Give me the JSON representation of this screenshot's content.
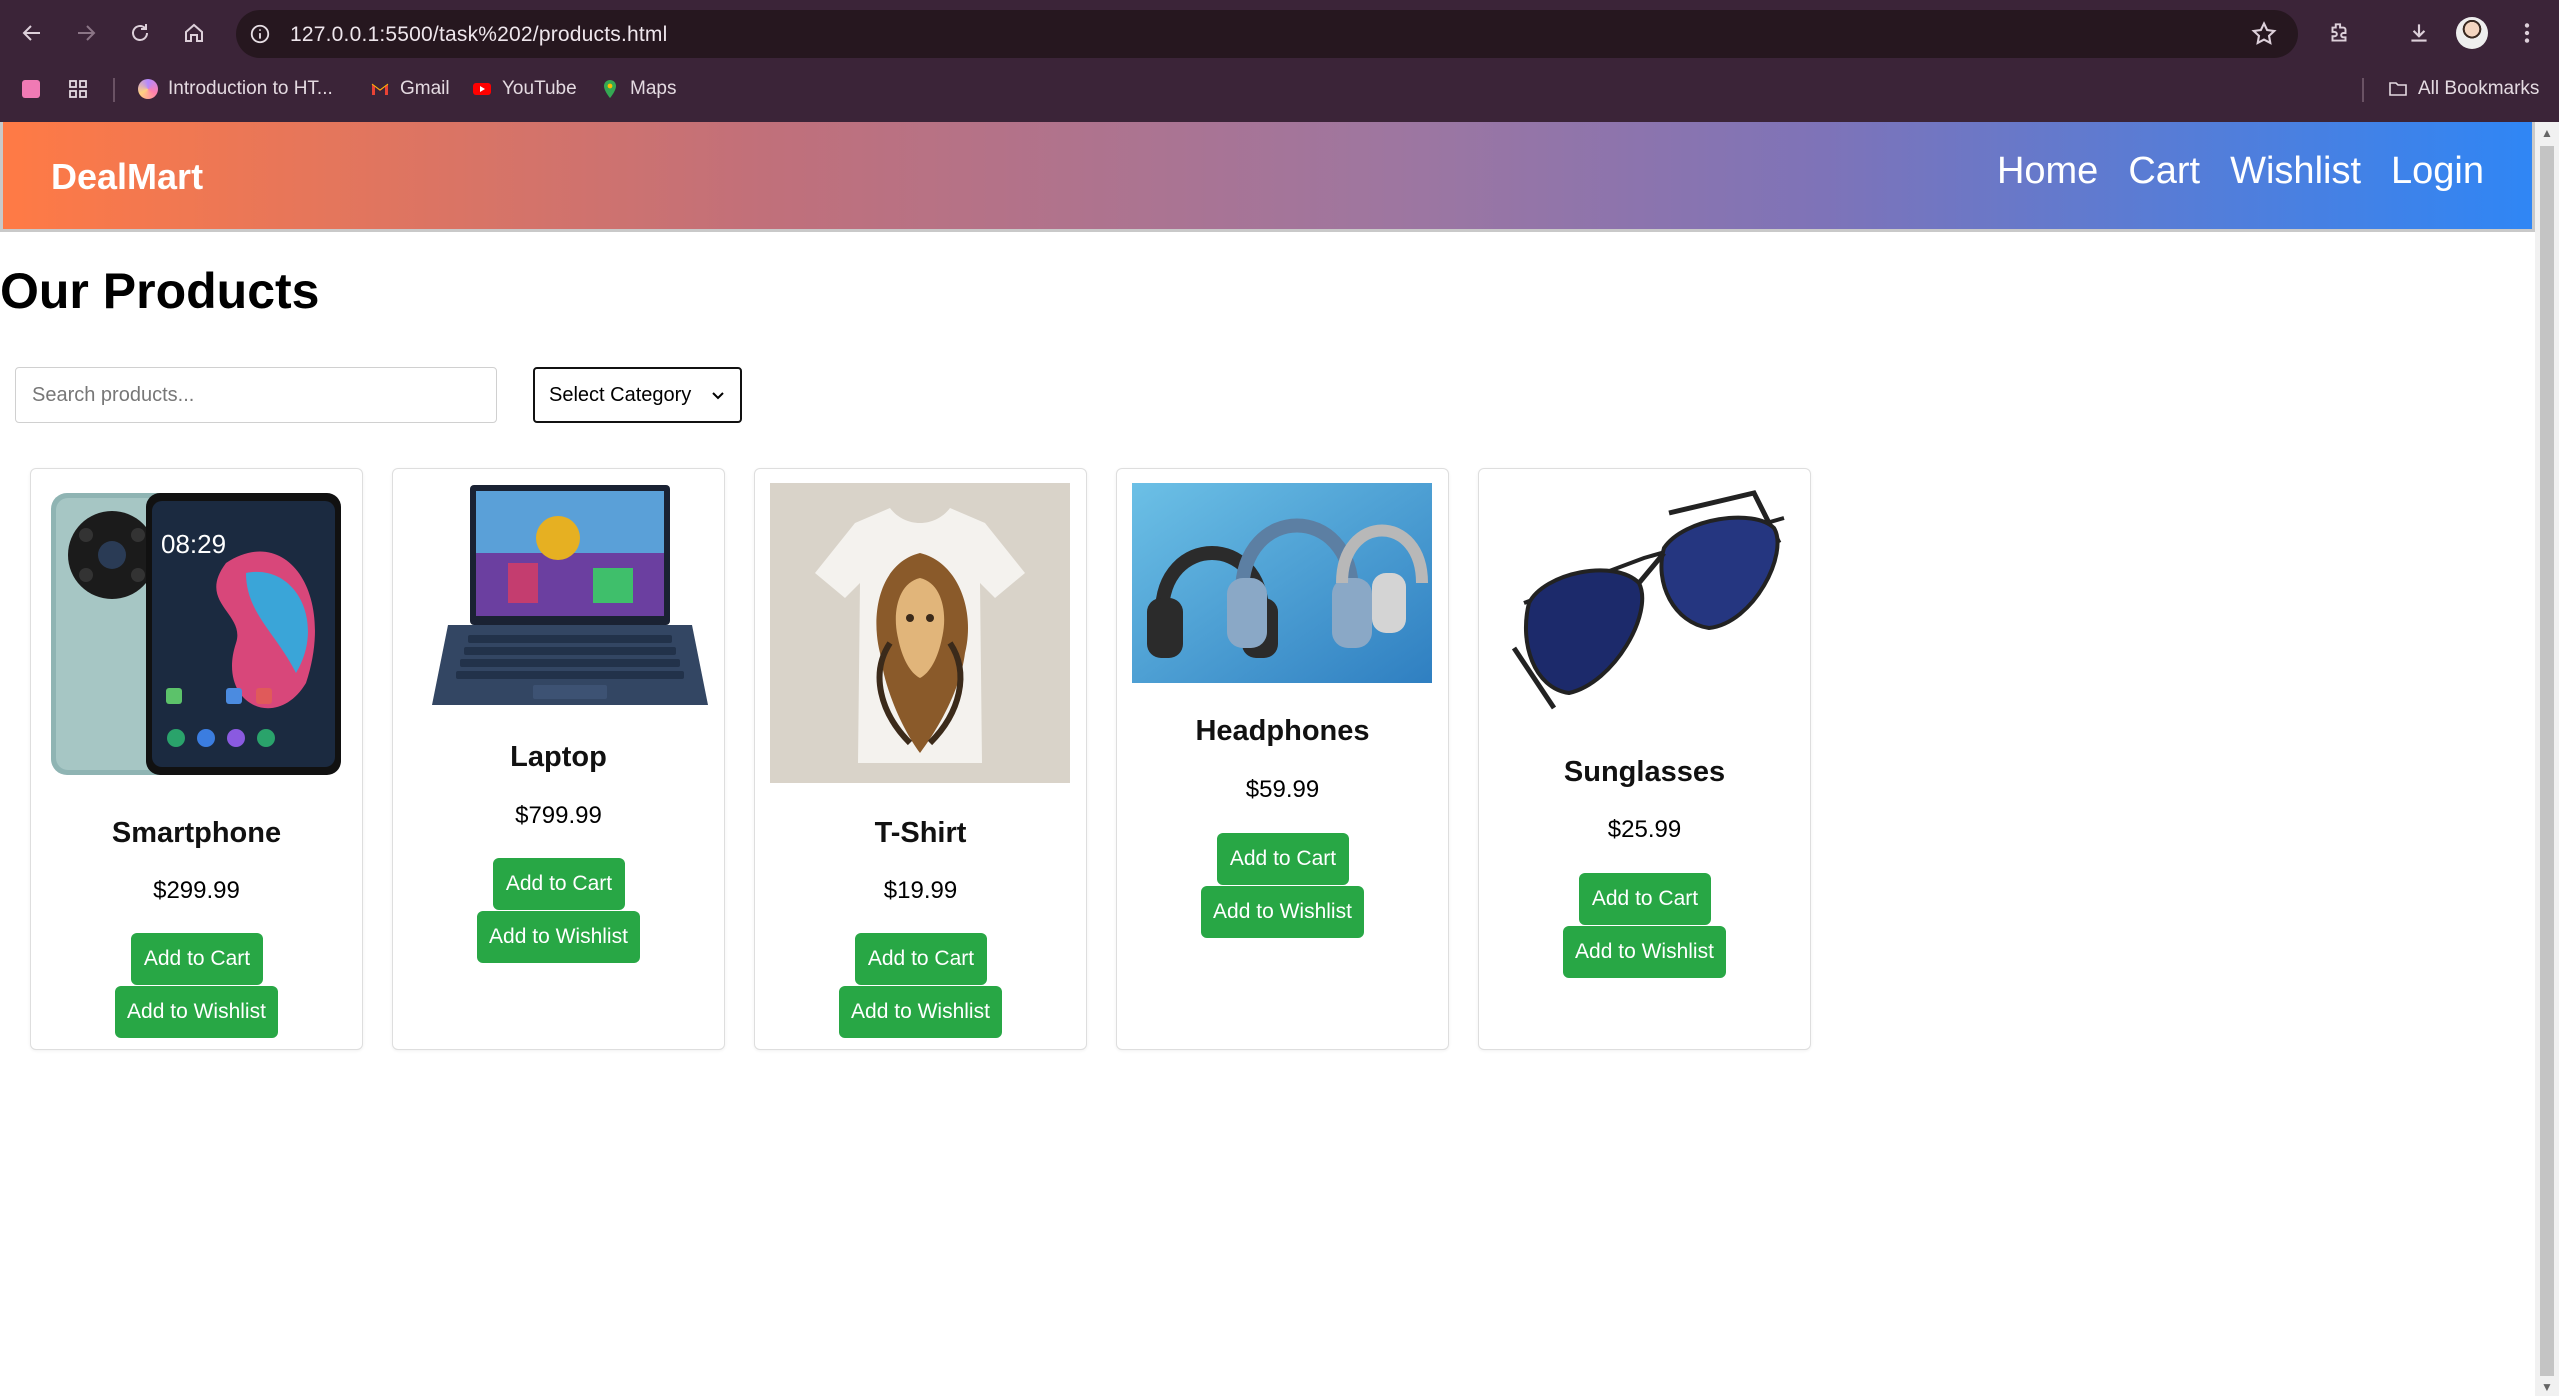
{
  "browser": {
    "url": "127.0.0.1:5500/task%202/products.html",
    "bookmarks": [
      {
        "label": "Introduction to HT..."
      },
      {
        "label": "Gmail"
      },
      {
        "label": "YouTube"
      },
      {
        "label": "Maps"
      }
    ],
    "all_bookmarks": "All Bookmarks"
  },
  "site": {
    "brand": "DealMart",
    "nav": [
      "Home",
      "Cart",
      "Wishlist",
      "Login"
    ]
  },
  "page": {
    "title": "Our Products",
    "search_placeholder": "Search products...",
    "category_select": "Select Category"
  },
  "products": [
    {
      "name": "Smartphone",
      "price": "$299.99",
      "image": "smartphone-image",
      "cart_label": "Add to Cart",
      "wishlist_label": "Add to Wishlist"
    },
    {
      "name": "Laptop",
      "price": "$799.99",
      "image": "laptop-image",
      "cart_label": "Add to Cart",
      "wishlist_label": "Add to Wishlist"
    },
    {
      "name": "T-Shirt",
      "price": "$19.99",
      "image": "tshirt-image",
      "cart_label": "Add to Cart",
      "wishlist_label": "Add to Wishlist"
    },
    {
      "name": "Headphones",
      "price": "$59.99",
      "image": "headphones-image",
      "cart_label": "Add to Cart",
      "wishlist_label": "Add to Wishlist"
    },
    {
      "name": "Sunglasses",
      "price": "$25.99",
      "image": "sunglasses-image",
      "cart_label": "Add to Cart",
      "wishlist_label": "Add to Wishlist"
    }
  ],
  "colors": {
    "button": "#28a745",
    "nav_gradient_start": "#ff7a45",
    "nav_gradient_end": "#2f86f5",
    "chrome_bg": "#3b2438"
  }
}
